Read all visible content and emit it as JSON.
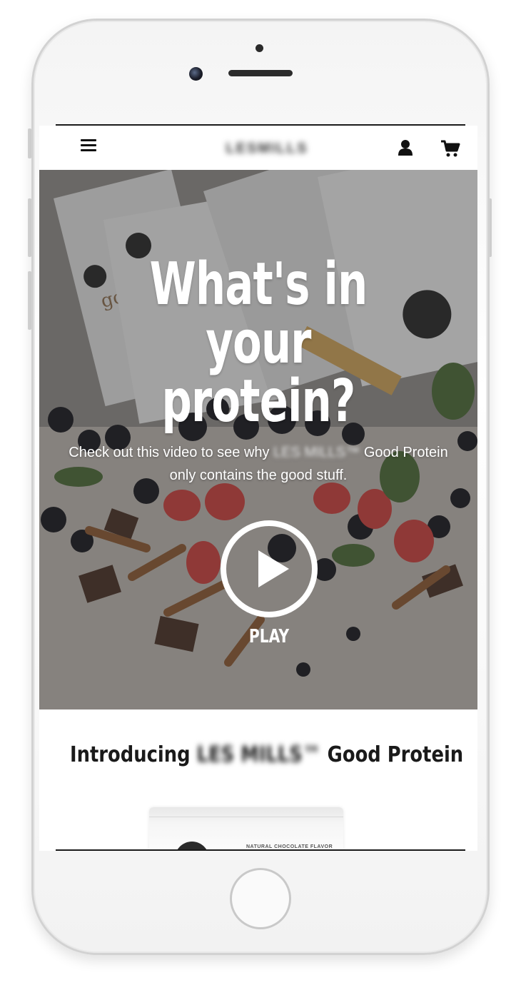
{
  "header": {
    "logo_text": "LESMILLS",
    "menu_icon": "hamburger-menu-icon",
    "account_icon": "user-icon",
    "cart_icon": "shopping-cart-icon"
  },
  "hero": {
    "title_line1": "What's in your",
    "title_line2": "protein?",
    "text_before": "Check out this video to see why",
    "text_brand": "LES MILLS™",
    "text_after": "Good Protein",
    "text_line2": "only contains the good stuff.",
    "play_label": "PLAY",
    "package_text": "good protein."
  },
  "intro": {
    "before": "Introducing",
    "brand": "LES MILLS™",
    "after": "Good Protein"
  },
  "product": {
    "label": "NATURAL CHOCOLATE FLAVOR"
  },
  "colors": {
    "hero_overlay": "#464646",
    "text_white": "#ffffff",
    "heading_dark": "#1a1a1a"
  }
}
